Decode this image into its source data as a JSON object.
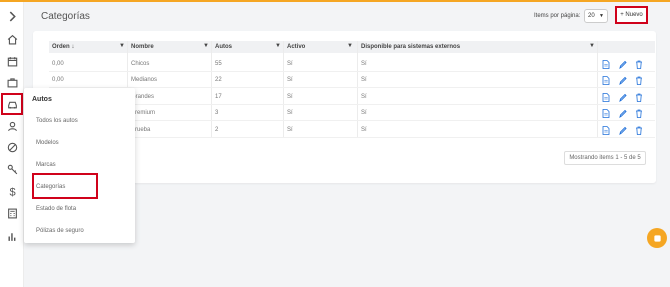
{
  "header": {
    "title": "Categorías",
    "per_page_label": "Items por página:",
    "per_page_value": "20",
    "new_button": "+ Nuevo"
  },
  "sidebar": {
    "icons": [
      "chevron-right-icon",
      "home-icon",
      "calendar-icon",
      "briefcase-icon",
      "car-icon",
      "user-icon",
      "ban-icon",
      "key-icon",
      "dollar-icon",
      "calculator-icon",
      "bar-chart-icon"
    ],
    "active": "car-icon"
  },
  "flyout": {
    "title": "Autos",
    "items": [
      "Todos los autos",
      "Modelos",
      "Marcas",
      "Categorías",
      "Estado de flota",
      "Pólizas de seguro"
    ],
    "selected": "Categorías"
  },
  "table": {
    "columns": [
      "Orden ↓",
      "Nombre",
      "Autos",
      "Activo",
      "Disponible para sistemas externos"
    ],
    "rows": [
      [
        "0,00",
        "Chicos",
        "55",
        "Sí",
        "Sí"
      ],
      [
        "0,00",
        "Medianos",
        "22",
        "Sí",
        "Sí"
      ],
      [
        "",
        "Grandes",
        "17",
        "Sí",
        "Sí"
      ],
      [
        "",
        "Premium",
        "3",
        "Sí",
        "Sí"
      ],
      [
        "",
        "Prueba",
        "2",
        "Sí",
        "Sí"
      ]
    ],
    "pager": "Mostrando items 1 - 5 de 5"
  },
  "colors": {
    "accent": "#f5a623",
    "highlight": "#d0021b",
    "action_blue": "#1e6fd9"
  }
}
